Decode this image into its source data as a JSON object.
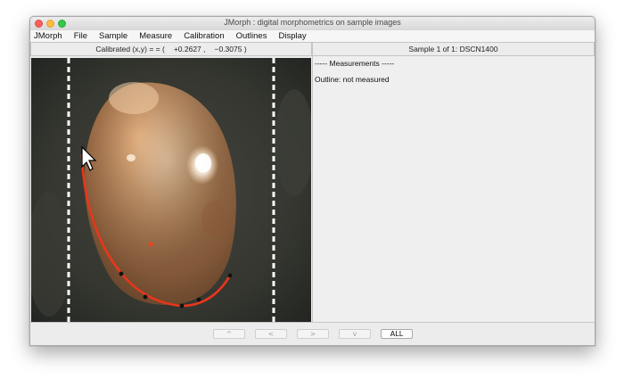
{
  "window": {
    "title": "JMorph : digital morphometrics on sample images"
  },
  "menu": [
    "JMorph",
    "File",
    "Sample",
    "Measure",
    "Calibration",
    "Outlines",
    "Display"
  ],
  "header": {
    "coord_label": "Calibrated (x,y) = = (",
    "coord_x": "+0.2627 ,",
    "coord_y": "−0.3075 )",
    "sample_label": "Sample 1 of 1: DSCN1400"
  },
  "measurements": {
    "title": "----- Measurements -----",
    "outline_line": "Outline: not measured"
  },
  "nav_buttons": {
    "up": "^",
    "prev": "<",
    "next": ">",
    "down": "v",
    "all": "ALL"
  },
  "colors": {
    "outline": "#e8361c",
    "marker_point": "#ff3a1a",
    "landmark": "#111111",
    "guide_line": "#ffffff"
  },
  "icons": {
    "cursor": "arrow-cursor-icon"
  }
}
